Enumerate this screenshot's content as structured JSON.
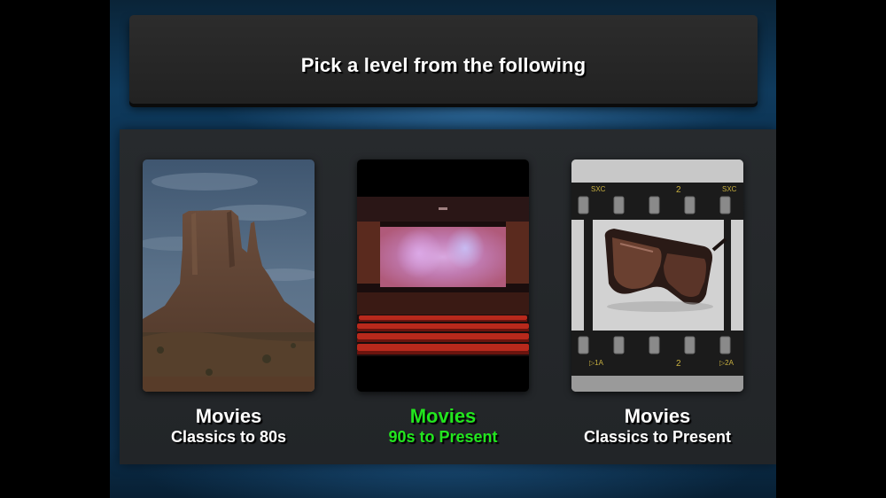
{
  "header": {
    "title": "Pick a level from the following"
  },
  "levels": [
    {
      "title": "Movies",
      "subtitle": "Classics to 80s",
      "image": "monument-valley-butte",
      "selected": false
    },
    {
      "title": "Movies",
      "subtitle": "90s to Present",
      "image": "movie-theater-screen",
      "selected": true
    },
    {
      "title": "Movies",
      "subtitle": "Classics to Present",
      "image": "film-strip-sunglasses",
      "selected": false
    }
  ],
  "film_strip": {
    "top_left": "SXC",
    "top_mid": "2",
    "top_right": "SXC",
    "bottom_left": "▷1A",
    "bottom_mid": "2",
    "bottom_right": "▷2A"
  },
  "colors": {
    "selected_text": "#22e61e",
    "normal_text": "#ffffff",
    "panel": "#25282b",
    "title_bar": "#272727"
  }
}
